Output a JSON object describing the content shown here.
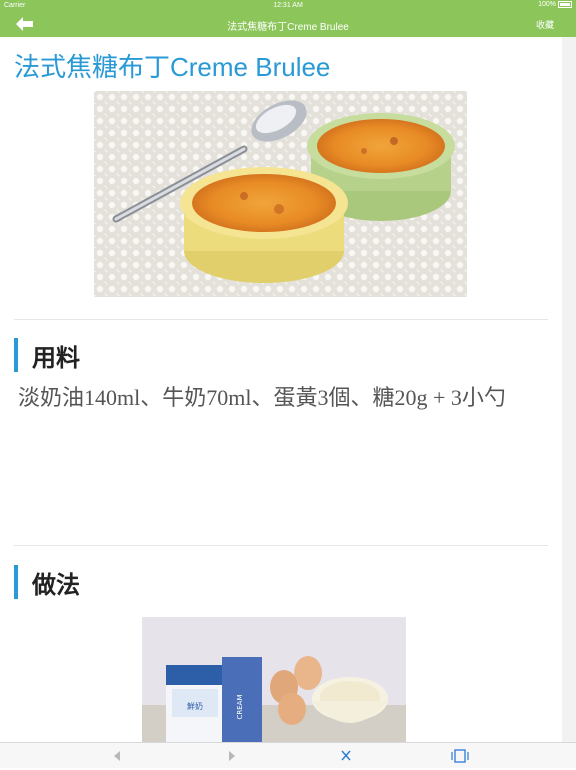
{
  "status": {
    "carrier": "Carrier",
    "time": "12:31 AM",
    "battery": "100%"
  },
  "nav": {
    "title": "法式焦糖布丁Creme Brulee",
    "favorite": "收藏"
  },
  "recipe": {
    "title": "法式焦糖布丁Creme Brulee",
    "ingredients_heading": "用料",
    "ingredients": "淡奶油140ml、牛奶70ml、蛋黃3個、糖20g + 3小勺",
    "method_heading": "做法"
  },
  "step_photo": {
    "carton_left": "鮮奶",
    "carton_right": "CREAM"
  },
  "colors": {
    "accent": "#8cc65b",
    "title_blue": "#2a9ad6"
  },
  "toolbar": {
    "items": [
      "back-arrow-icon",
      "forward-arrow-icon",
      "close-icon",
      "rotate-icon"
    ]
  }
}
